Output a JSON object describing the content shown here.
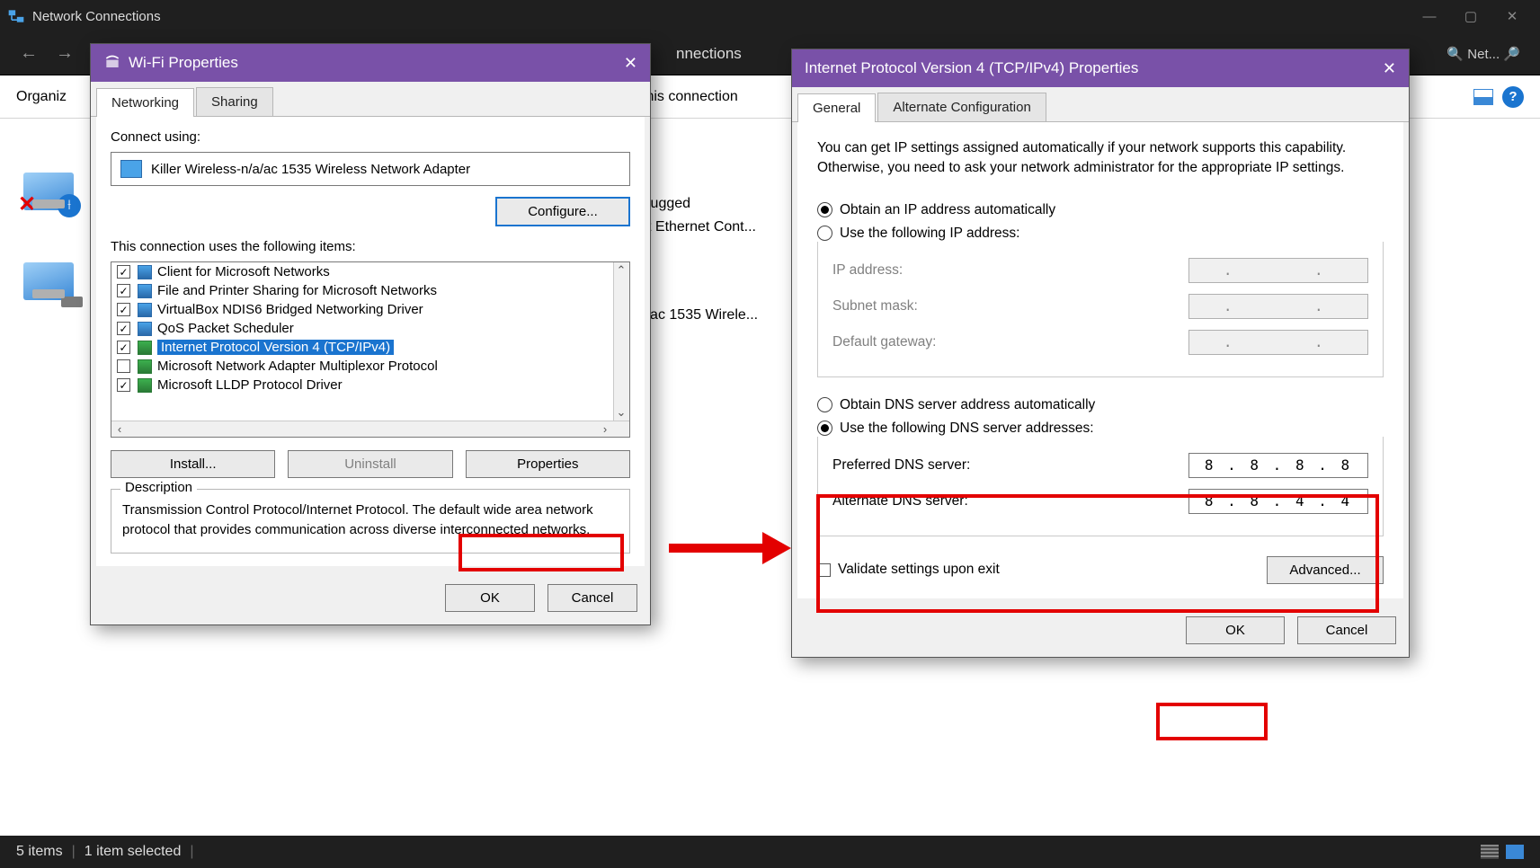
{
  "window": {
    "title": "Network Connections"
  },
  "nav": {
    "breadcrumb_tail": "nnections",
    "search_text": "Net..."
  },
  "toolbar": {
    "organize": "Organiz",
    "action_fragment": "this connection"
  },
  "bg": {
    "unplugged": "lugged",
    "eth": "t Ethernet Cont...",
    "wifi": "'ac 1535 Wirele..."
  },
  "wifi_dialog": {
    "title": "Wi-Fi Properties",
    "tabs": [
      "Networking",
      "Sharing"
    ],
    "connect_label": "Connect using:",
    "adapter": "Killer Wireless-n/a/ac 1535 Wireless Network Adapter",
    "configure_btn": "Configure...",
    "items_label": "This connection uses the following items:",
    "items": [
      {
        "checked": true,
        "icon": "mon",
        "label": "Client for Microsoft Networks",
        "selected": false
      },
      {
        "checked": true,
        "icon": "mon",
        "label": "File and Printer Sharing for Microsoft Networks",
        "selected": false
      },
      {
        "checked": true,
        "icon": "mon",
        "label": "VirtualBox NDIS6 Bridged Networking Driver",
        "selected": false
      },
      {
        "checked": true,
        "icon": "mon",
        "label": "QoS Packet Scheduler",
        "selected": false
      },
      {
        "checked": true,
        "icon": "net",
        "label": "Internet Protocol Version 4 (TCP/IPv4)",
        "selected": true
      },
      {
        "checked": false,
        "icon": "net",
        "label": "Microsoft Network Adapter Multiplexor Protocol",
        "selected": false
      },
      {
        "checked": true,
        "icon": "net",
        "label": "Microsoft LLDP Protocol Driver",
        "selected": false
      }
    ],
    "install_btn": "Install...",
    "uninstall_btn": "Uninstall",
    "properties_btn": "Properties",
    "desc_legend": "Description",
    "desc_text": "Transmission Control Protocol/Internet Protocol. The default wide area network protocol that provides communication across diverse interconnected networks.",
    "ok": "OK",
    "cancel": "Cancel"
  },
  "ipv4_dialog": {
    "title": "Internet Protocol Version 4 (TCP/IPv4) Properties",
    "tabs": [
      "General",
      "Alternate Configuration"
    ],
    "intro": "You can get IP settings assigned automatically if your network supports this capability. Otherwise, you need to ask your network administrator for the appropriate IP settings.",
    "ip_auto": "Obtain an IP address automatically",
    "ip_manual": "Use the following IP address:",
    "ip_addr_label": "IP address:",
    "subnet_label": "Subnet mask:",
    "gateway_label": "Default gateway:",
    "dns_auto": "Obtain DNS server address automatically",
    "dns_manual": "Use the following DNS server addresses:",
    "pref_dns_label": "Preferred DNS server:",
    "alt_dns_label": "Alternate DNS server:",
    "pref_dns": "8 . 8 . 8 . 8",
    "alt_dns": "8 . 8 . 4 . 4",
    "validate": "Validate settings upon exit",
    "advanced": "Advanced...",
    "ok": "OK",
    "cancel": "Cancel"
  },
  "status": {
    "items": "5 items",
    "selected": "1 item selected"
  }
}
